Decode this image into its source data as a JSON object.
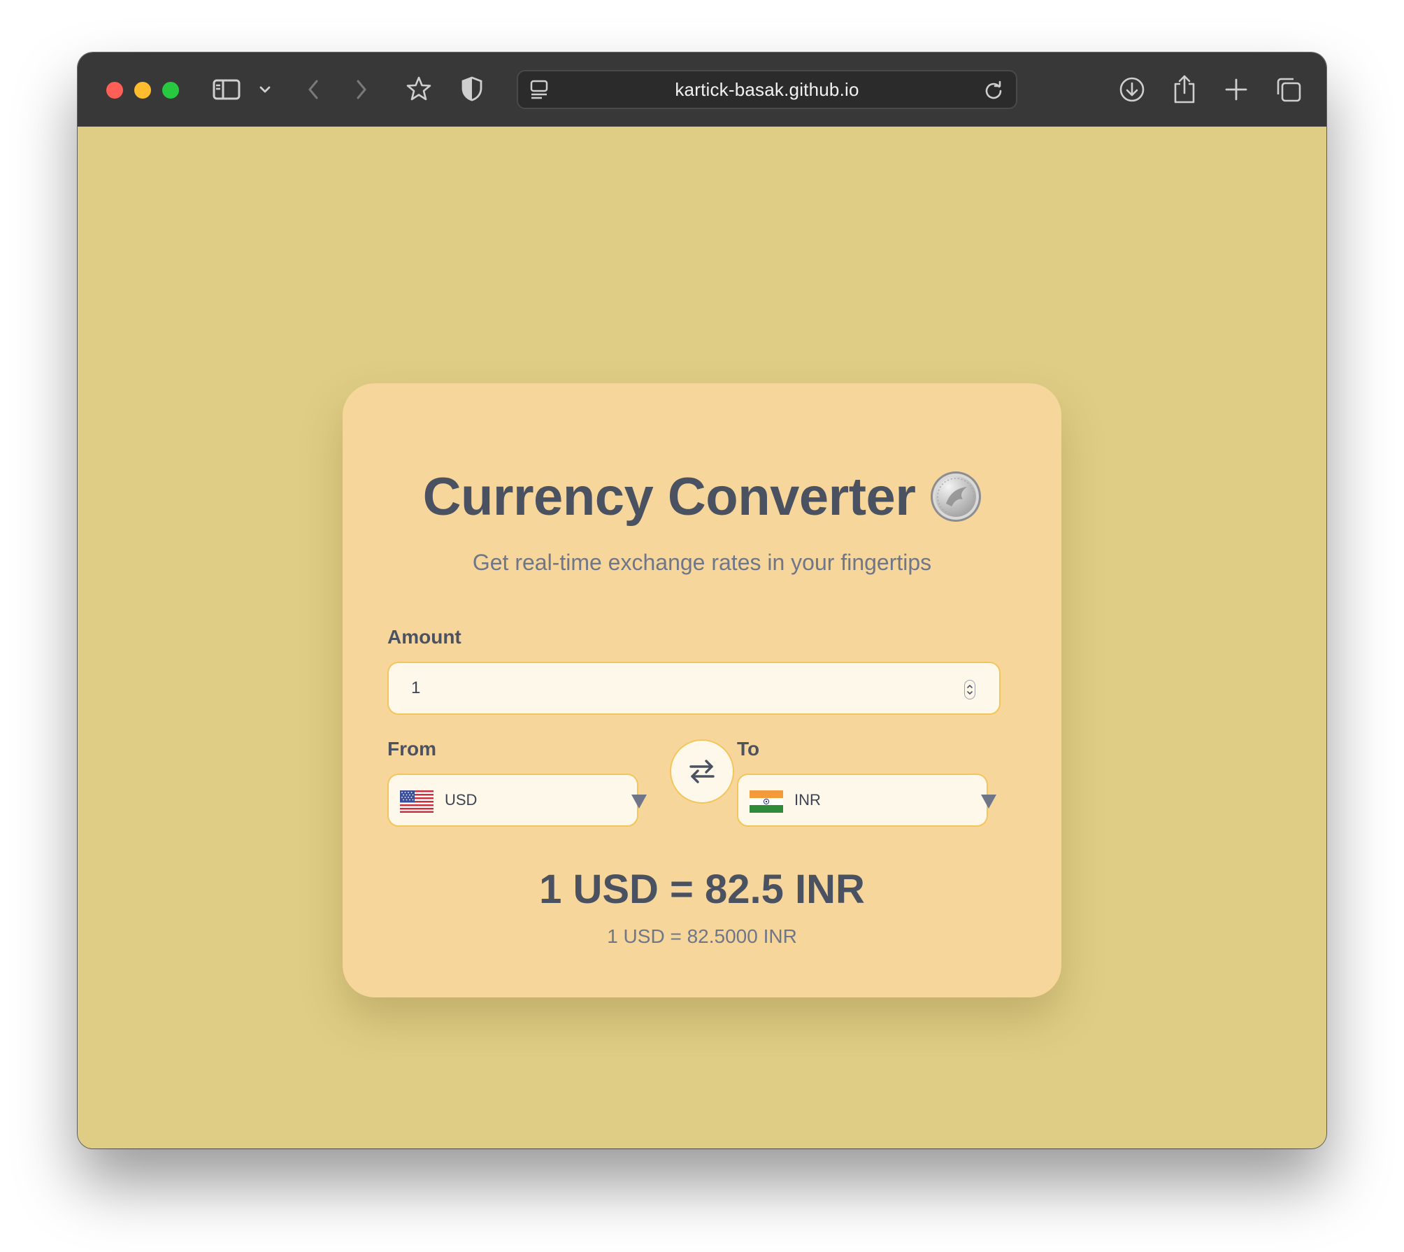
{
  "browser": {
    "url": "kartick-basak.github.io"
  },
  "app": {
    "title": "Currency Converter",
    "title_icon": "coin-icon",
    "subtitle": "Get real-time exchange rates in your fingertips",
    "amount_label": "Amount",
    "amount_value": "1",
    "from_label": "From",
    "to_label": "To",
    "from_currency": {
      "code": "USD",
      "flag": "us-flag-icon"
    },
    "to_currency": {
      "code": "INR",
      "flag": "india-flag-icon"
    },
    "result_main": "1 USD = 82.5 INR",
    "result_detail": "1 USD = 82.5000 INR"
  },
  "colors": {
    "page_background": "#dfcd85",
    "card_background": "#f6d69b",
    "input_border": "#f3c55a",
    "input_background": "#fdf8ea",
    "text_primary": "#4a5161",
    "text_secondary": "#6f7688"
  }
}
